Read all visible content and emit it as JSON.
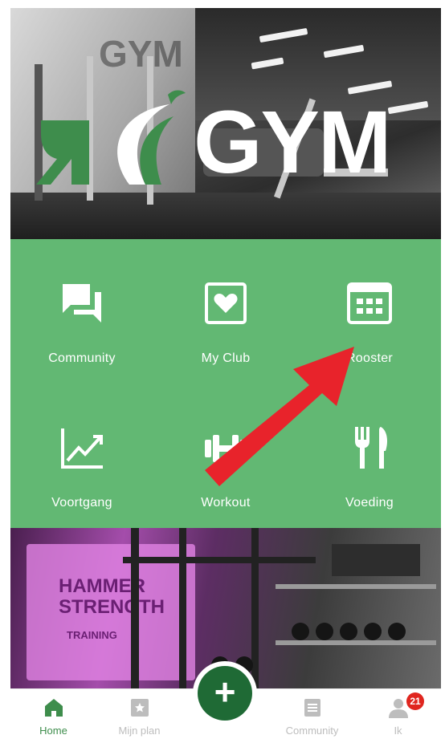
{
  "hero": {
    "logo_text": "GYM",
    "wall_text": "GYM"
  },
  "menu": {
    "items": [
      {
        "label": "Community",
        "icon": "chat-bubbles-icon"
      },
      {
        "label": "My Club",
        "icon": "heart-card-icon"
      },
      {
        "label": "Rooster",
        "icon": "calendar-icon"
      },
      {
        "label": "Voortgang",
        "icon": "chart-line-icon"
      },
      {
        "label": "Workout",
        "icon": "dumbbell-icon"
      },
      {
        "label": "Voeding",
        "icon": "fork-knife-icon"
      }
    ],
    "colors": {
      "tile_bg": "#62b873",
      "text": "#ffffff"
    }
  },
  "annotation": {
    "arrow_color": "#e8232b"
  },
  "photo": {
    "wall_text": "HAMMER STRENGTH",
    "sub_text": "TRAINING"
  },
  "nav": {
    "items": [
      {
        "label": "Home",
        "icon": "home-icon",
        "active": true
      },
      {
        "label": "Mijn plan",
        "icon": "star-card-icon",
        "active": false
      },
      {
        "label": "Community",
        "icon": "document-icon",
        "active": false
      },
      {
        "label": "Ik",
        "icon": "person-icon",
        "active": false
      }
    ],
    "fab_label": "+",
    "badge_count": "21",
    "colors": {
      "active": "#3e8d4c",
      "inactive": "#bdbdbd",
      "fab": "#1f6a35",
      "badge": "#e0261f"
    }
  }
}
